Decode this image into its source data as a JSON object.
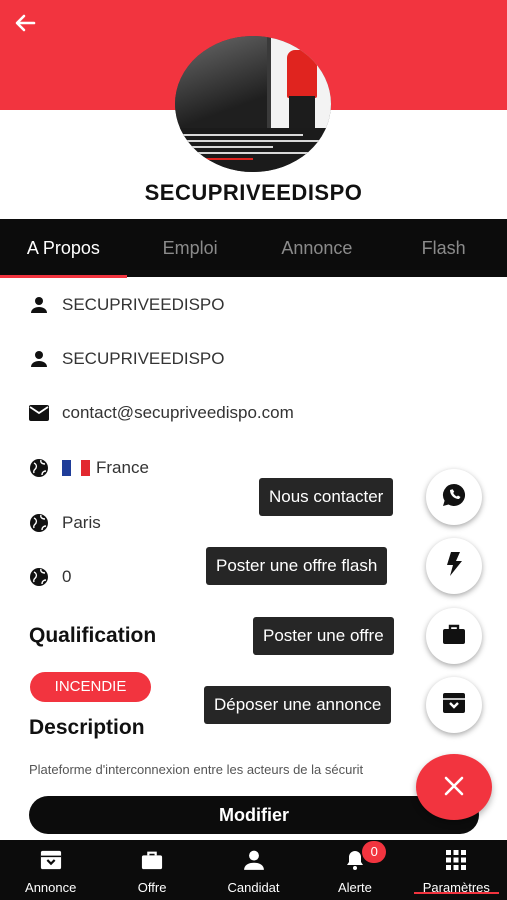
{
  "profile": {
    "name": "SECUPRIVEEDISPO"
  },
  "tabs": [
    {
      "label": "A Propos",
      "active": true
    },
    {
      "label": "Emploi",
      "active": false
    },
    {
      "label": "Annonce",
      "active": false
    },
    {
      "label": "Flash",
      "active": false
    }
  ],
  "about": {
    "rows": [
      {
        "icon": "person-icon",
        "text": "SECUPRIVEEDISPO"
      },
      {
        "icon": "person-icon",
        "text": "SECUPRIVEEDISPO"
      },
      {
        "icon": "mail-icon",
        "text": "contact@secupriveedispo.com"
      },
      {
        "icon": "globe-icon",
        "text": "France",
        "flag": [
          "#1f3d99",
          "#ffffff",
          "#e2282f"
        ]
      },
      {
        "icon": "globe-icon",
        "text": "Paris"
      },
      {
        "icon": "globe-icon",
        "text": "0"
      }
    ]
  },
  "qualification": {
    "title": "Qualification",
    "chips": [
      "INCENDIE"
    ]
  },
  "description": {
    "title": "Description",
    "text": "Plateforme d'interconnexion entre les acteurs de la sécurit"
  },
  "actions": {
    "modify_label": "Modifier"
  },
  "fab_menu": {
    "items": [
      {
        "label": "Nous contacter",
        "icon": "whatsapp-icon"
      },
      {
        "label": "Poster une offre flash",
        "icon": "flash-icon"
      },
      {
        "label": "Poster une offre",
        "icon": "briefcase-icon"
      },
      {
        "label": "Déposer une annonce",
        "icon": "archive-icon"
      }
    ],
    "close_icon": "close-icon"
  },
  "bottom_nav": {
    "items": [
      {
        "label": "Annonce",
        "icon": "archive-icon"
      },
      {
        "label": "Offre",
        "icon": "briefcase-icon"
      },
      {
        "label": "Candidat",
        "icon": "person-icon"
      },
      {
        "label": "Alerte",
        "icon": "bell-icon",
        "badge": "0"
      },
      {
        "label": "Paramètres",
        "icon": "grid-icon",
        "active": true
      }
    ]
  },
  "colors": {
    "accent": "#f2343f",
    "dark": "#0c0c0c"
  }
}
